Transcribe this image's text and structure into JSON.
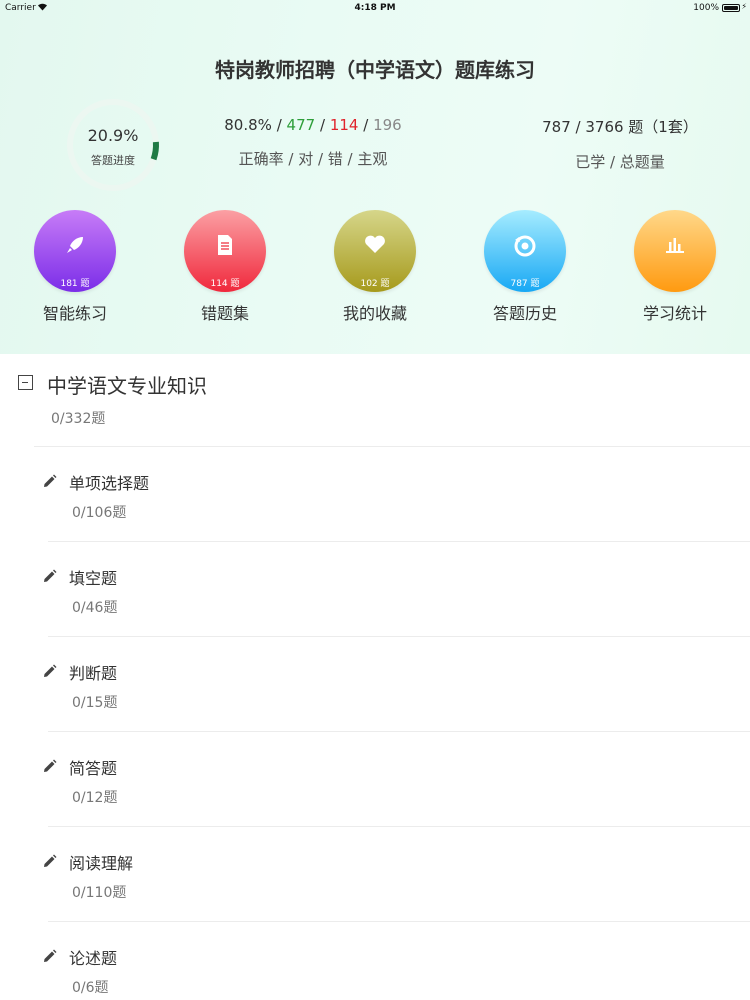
{
  "status_bar": {
    "carrier": "Carrier",
    "time": "4:18 PM",
    "battery": "100%"
  },
  "header": {
    "title": "特岗教师招聘（中学语文）题库练习",
    "progress": {
      "percent_text": "20.9%",
      "label": "答题进度",
      "fraction": 0.209
    },
    "accuracy": {
      "rate": "80.8%",
      "correct": "477",
      "wrong": "114",
      "subjective": "196",
      "slash": "/",
      "label": "正确率 / 对 / 错 / 主观"
    },
    "learned": {
      "value": "787 / 3766 题（1套）",
      "label": "已学 / 总题量"
    }
  },
  "features": [
    {
      "name": "智能练习",
      "count": "181 题",
      "icon": "rocket-icon",
      "color_top": "#c77cf7",
      "color_bottom": "#7b2de8"
    },
    {
      "name": "错题集",
      "count": "114 题",
      "icon": "document-icon",
      "color_top": "#fba0a4",
      "color_bottom": "#f0283c"
    },
    {
      "name": "我的收藏",
      "count": "102 题",
      "icon": "heart-icon",
      "color_top": "#d6d68a",
      "color_bottom": "#a69a1c"
    },
    {
      "name": "答题历史",
      "count": "787 题",
      "icon": "history-icon",
      "color_top": "#a6ecff",
      "color_bottom": "#18a8f4"
    },
    {
      "name": "学习统计",
      "count": "",
      "icon": "bar-chart-icon",
      "color_top": "#ffd88a",
      "color_bottom": "#ff9a10"
    }
  ],
  "section": {
    "title": "中学语文专业知识",
    "count": "0/332题"
  },
  "items": [
    {
      "name": "单项选择题",
      "count": "0/106题"
    },
    {
      "name": "填空题",
      "count": "0/46题"
    },
    {
      "name": "判断题",
      "count": "0/15题"
    },
    {
      "name": "简答题",
      "count": "0/12题"
    },
    {
      "name": "阅读理解",
      "count": "0/110题"
    },
    {
      "name": "论述题",
      "count": "0/6题"
    }
  ],
  "colors": {
    "correct": "#2e9e3a",
    "wrong": "#e0242c",
    "progress_ring": "#1f7a45"
  }
}
